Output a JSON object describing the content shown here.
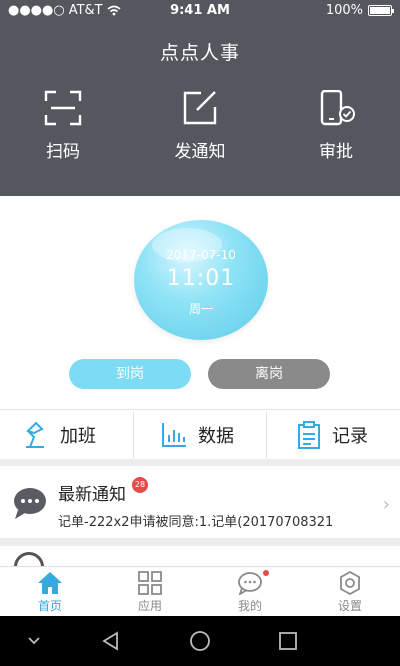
{
  "status_bar": {
    "carrier": "AT&T",
    "time": "9:41 AM",
    "battery": "100%",
    "battery_level": 1.0
  },
  "header": {
    "title": "点点人事",
    "actions": [
      {
        "label": "扫码",
        "icon": "scan-icon"
      },
      {
        "label": "发通知",
        "icon": "edit-icon"
      },
      {
        "label": "审批",
        "icon": "phone-check-icon"
      }
    ]
  },
  "clock": {
    "date": "2017-07-10",
    "time": "11:01",
    "weekday": "周一"
  },
  "punch": {
    "arrive_label": "到岗",
    "leave_label": "离岗"
  },
  "quick_links": [
    {
      "label": "加班",
      "icon": "overtime-lamp-icon"
    },
    {
      "label": "数据",
      "icon": "bar-chart-icon"
    },
    {
      "label": "记录",
      "icon": "clipboard-icon"
    }
  ],
  "notice": {
    "title": "最新通知",
    "badge": "28",
    "preview": "记单-222x2申请被同意:1.记单(20170708321",
    "icon": "chat-bubble-icon"
  },
  "tabbar": [
    {
      "label": "首页",
      "icon": "home-icon",
      "active": true
    },
    {
      "label": "应用",
      "icon": "apps-grid-icon",
      "active": false
    },
    {
      "label": "我的",
      "icon": "message-icon",
      "active": false,
      "dot": true
    },
    {
      "label": "设置",
      "icon": "settings-icon",
      "active": false
    }
  ],
  "colors": {
    "header_bg": "#55575f",
    "accent": "#36a9e1",
    "arrive": "#7ddcf3",
    "leave": "#8a8a8a",
    "badge": "#e84a4a"
  }
}
